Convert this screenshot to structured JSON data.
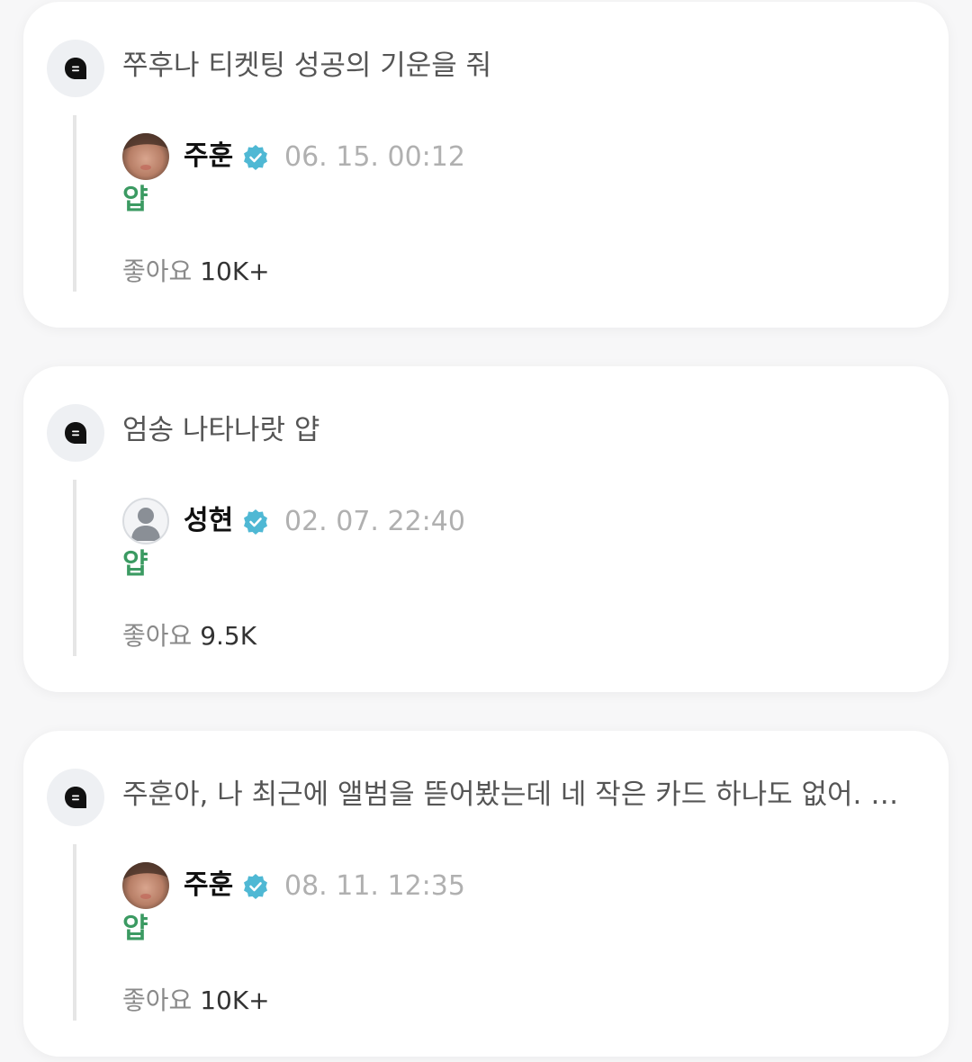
{
  "cards": [
    {
      "question": "쭈후나 티켓팅 성공의 기운을 줘",
      "author": "주훈",
      "timestamp": "06. 15. 00:12",
      "answer": "얍",
      "likes_label": "좋아요",
      "likes_count": "10K+",
      "avatar": "photo"
    },
    {
      "question": "엄송 나타나랏 얍",
      "author": "성현",
      "timestamp": "02. 07. 22:40",
      "answer": "얍",
      "likes_label": "좋아요",
      "likes_count": "9.5K",
      "avatar": "default"
    },
    {
      "question": "주훈아, 나 최근에 앨범을 뜯어봤는데 네 작은 카드 하나도 없어. 너...",
      "author": "주훈",
      "timestamp": "08. 11. 12:35",
      "answer": "얍",
      "likes_label": "좋아요",
      "likes_count": "10K+",
      "avatar": "photo"
    }
  ],
  "icons": {
    "question": "speech-bubble-icon",
    "verified": "verified-badge-icon"
  },
  "colors": {
    "answer": "#3b9a62",
    "verified": "#4fb8d4",
    "timestamp": "#b0b0b0"
  }
}
